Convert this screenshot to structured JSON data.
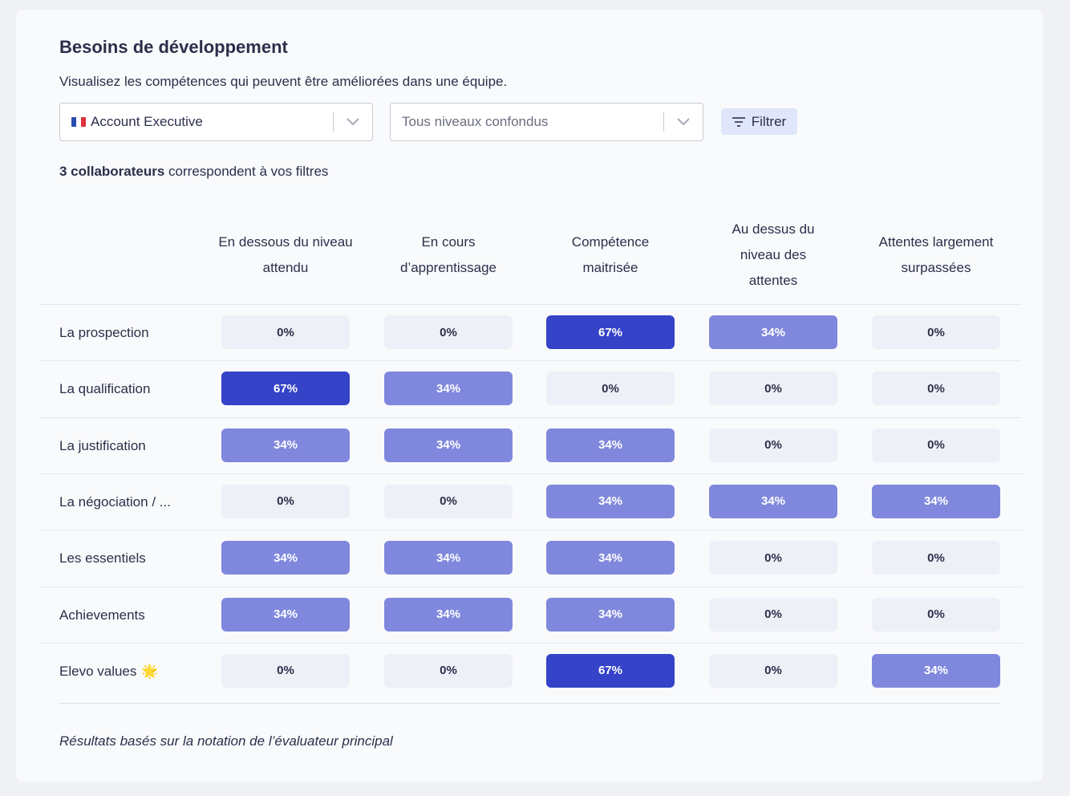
{
  "header": {
    "title": "Besoins de développement",
    "subtitle": "Visualisez les compétences qui peuvent être améliorées dans une équipe."
  },
  "filters": {
    "job_select": {
      "value": "Account Executive",
      "flag_icon": "france-flag-icon"
    },
    "level_select": {
      "placeholder": "Tous niveaux confondus"
    },
    "filter_button": {
      "label": "Filtrer",
      "icon": "filter-lines-icon"
    }
  },
  "result_count": {
    "bold": "3 collaborateurs",
    "rest": " correspondent à vos filtres"
  },
  "columns": [
    "En dessous du niveau attendu",
    "En cours d’apprentissage",
    "Compétence maitrisée",
    "Au dessus du niveau des attentes",
    "Attentes largement surpassées"
  ],
  "rows": [
    {
      "label": "La prospection",
      "values": [
        "0%",
        "0%",
        "67%",
        "34%",
        "0%"
      ]
    },
    {
      "label": "La qualification",
      "values": [
        "67%",
        "34%",
        "0%",
        "0%",
        "0%"
      ]
    },
    {
      "label": "La justification",
      "values": [
        "34%",
        "34%",
        "34%",
        "0%",
        "0%"
      ]
    },
    {
      "label": "La négociation / ...",
      "values": [
        "0%",
        "0%",
        "34%",
        "34%",
        "34%"
      ]
    },
    {
      "label": "Les essentiels",
      "values": [
        "34%",
        "34%",
        "34%",
        "0%",
        "0%"
      ]
    },
    {
      "label": "Achievements",
      "values": [
        "34%",
        "34%",
        "34%",
        "0%",
        "0%"
      ]
    },
    {
      "label": "Elevo values",
      "emoji": "🌟",
      "values": [
        "0%",
        "0%",
        "67%",
        "0%",
        "34%"
      ]
    }
  ],
  "colors": {
    "zero": "#eef0f7",
    "low": "#7f88dc",
    "high": "#3443c8"
  },
  "footnote": "Résultats basés sur la notation de l’évaluateur principal"
}
